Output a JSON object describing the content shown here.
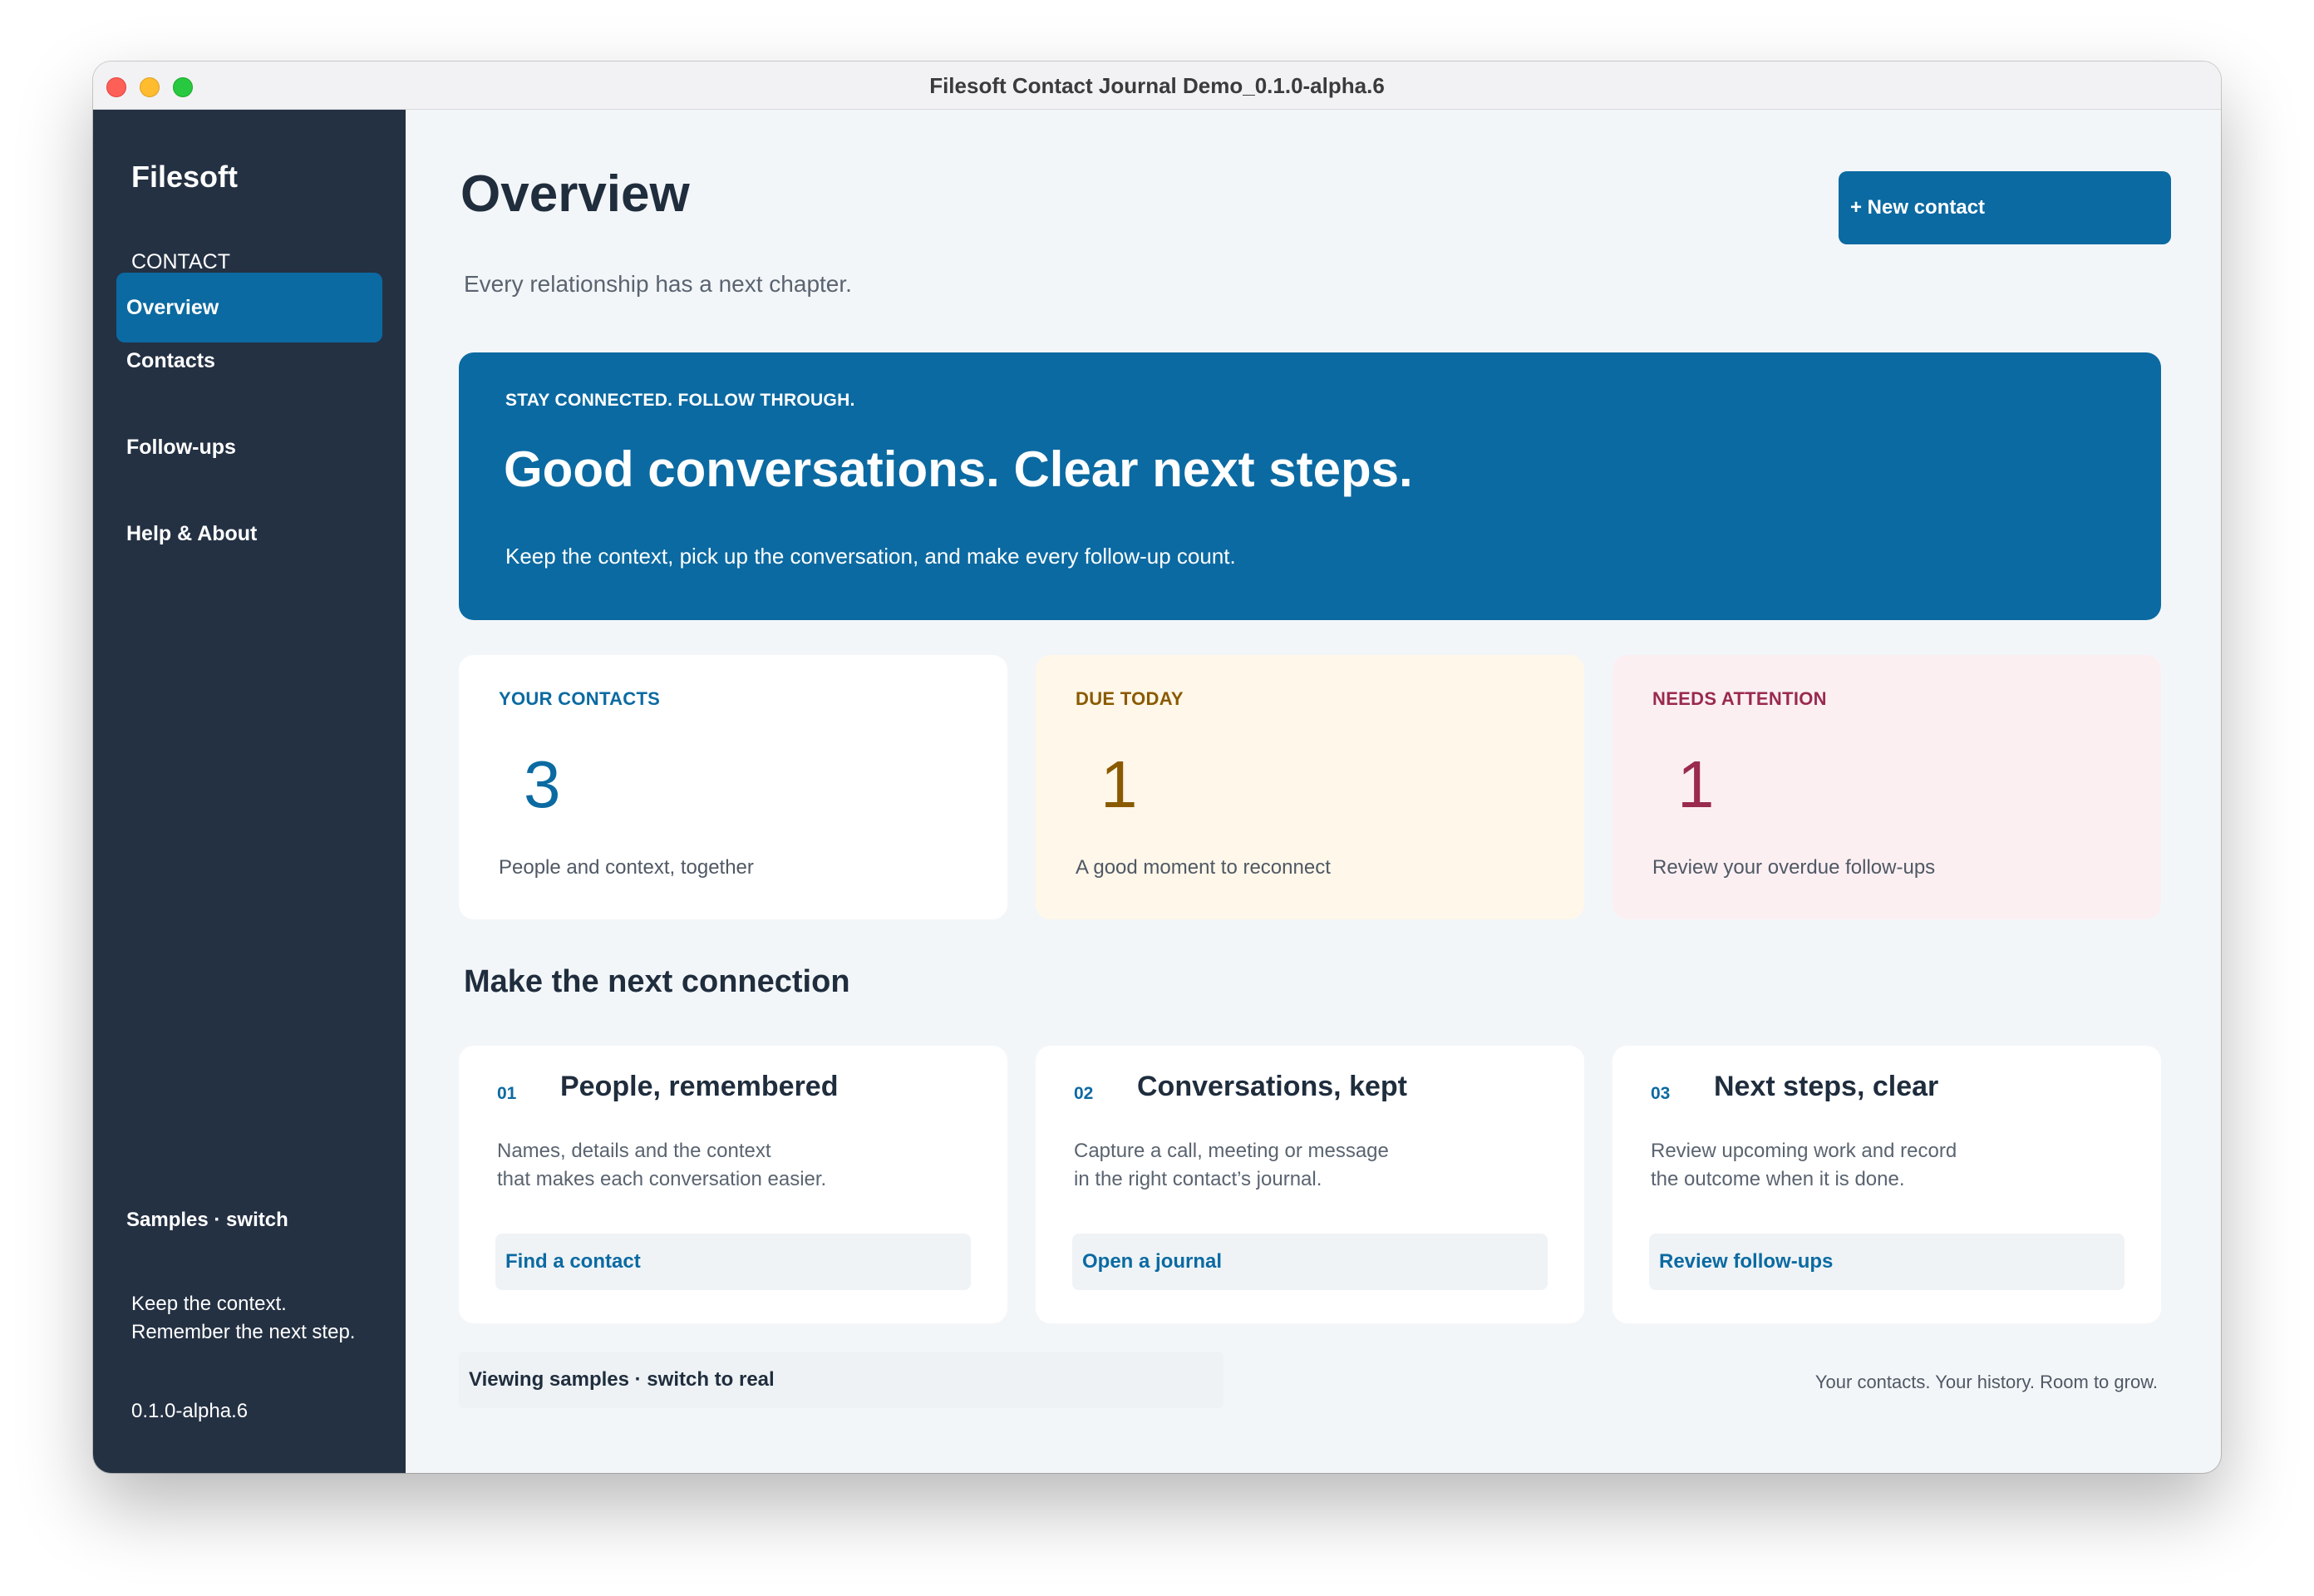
{
  "window": {
    "title": "Filesoft Contact Journal Demo_0.1.0-alpha.6"
  },
  "sidebar": {
    "brand": "Filesoft",
    "subtitle": "CONTACT JOURNAL",
    "items": [
      {
        "label": "Overview",
        "active": true
      },
      {
        "label": "Contacts",
        "active": false
      },
      {
        "label": "Follow-ups",
        "active": false
      },
      {
        "label": "Help & About",
        "active": false
      }
    ],
    "samples_switch": "Samples · switch",
    "tagline_line1": "Keep the context.",
    "tagline_line2": "Remember the next step.",
    "version": "0.1.0-alpha.6"
  },
  "header": {
    "title": "Overview",
    "subtitle": "Every relationship has a next chapter.",
    "new_contact_label": "+ New contact"
  },
  "hero": {
    "eyebrow": "STAY CONNECTED. FOLLOW THROUGH.",
    "title": "Good conversations. Clear next steps.",
    "body": "Keep the context, pick up the conversation, and make every follow-up count."
  },
  "stats": [
    {
      "label": "YOUR CONTACTS",
      "value": "3",
      "desc": "People and context, together"
    },
    {
      "label": "DUE TODAY",
      "value": "1",
      "desc": "A good moment to reconnect"
    },
    {
      "label": "NEEDS ATTENTION",
      "value": "1",
      "desc": "Review your overdue follow-ups"
    }
  ],
  "section": {
    "title": "Make the next connection"
  },
  "cards": [
    {
      "num": "01",
      "title": "People, remembered",
      "body_line1": "Names, details and the context",
      "body_line2": "that makes each conversation easier.",
      "link": "Find a contact"
    },
    {
      "num": "02",
      "title": "Conversations, kept",
      "body_line1": "Capture a call, meeting or message",
      "body_line2": "in the right contact’s journal.",
      "link": "Open a journal"
    },
    {
      "num": "03",
      "title": "Next steps, clear",
      "body_line1": "Review upcoming work and record",
      "body_line2": "the outcome when it is done.",
      "link": "Review follow-ups"
    }
  ],
  "footer": {
    "samples_bar": "Viewing samples · switch to real",
    "tagline": "Your contacts. Your history. Room to grow."
  },
  "colors": {
    "accent": "#0b6aa2",
    "sidebar": "#243143",
    "due": "#8a5a00",
    "attention": "#9a2a4e"
  }
}
